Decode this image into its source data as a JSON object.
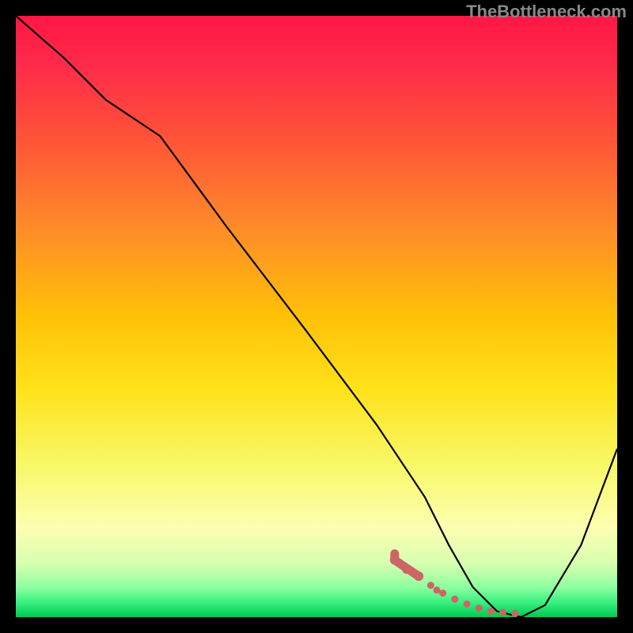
{
  "watermark": "TheBottleneck.com",
  "chart_data": {
    "type": "line",
    "title": "",
    "xlabel": "",
    "ylabel": "",
    "xlim": [
      0,
      100
    ],
    "ylim": [
      0,
      100
    ],
    "gradient_stops": [
      {
        "offset": 0.0,
        "color": "#ff1744"
      },
      {
        "offset": 0.08,
        "color": "#ff2a4a"
      },
      {
        "offset": 0.2,
        "color": "#ff5238"
      },
      {
        "offset": 0.35,
        "color": "#ff8a2a"
      },
      {
        "offset": 0.5,
        "color": "#ffc107"
      },
      {
        "offset": 0.62,
        "color": "#ffe21a"
      },
      {
        "offset": 0.75,
        "color": "#f8f86a"
      },
      {
        "offset": 0.85,
        "color": "#fdffb0"
      },
      {
        "offset": 0.91,
        "color": "#d8ffb0"
      },
      {
        "offset": 0.95,
        "color": "#8fff9f"
      },
      {
        "offset": 0.975,
        "color": "#3af081"
      },
      {
        "offset": 1.0,
        "color": "#00c853"
      }
    ],
    "series": [
      {
        "name": "bottleneck-curve",
        "x": [
          0,
          8,
          15,
          24,
          35,
          48,
          60,
          68,
          72,
          76,
          80,
          84,
          88,
          94,
          100
        ],
        "y": [
          100,
          93,
          86,
          80,
          65,
          48,
          32,
          20,
          12,
          5,
          1,
          0,
          2,
          12,
          28
        ]
      }
    ],
    "highlight_band": {
      "name": "optimal-range",
      "color": "#cc6666",
      "points_x": [
        63,
        65,
        67,
        69,
        70,
        71,
        73,
        75,
        77,
        79,
        81,
        83
      ],
      "points_y": [
        9.5,
        8.0,
        6.8,
        5.3,
        4.5,
        4.0,
        3.0,
        2.2,
        1.5,
        1.0,
        0.8,
        0.6
      ]
    }
  }
}
